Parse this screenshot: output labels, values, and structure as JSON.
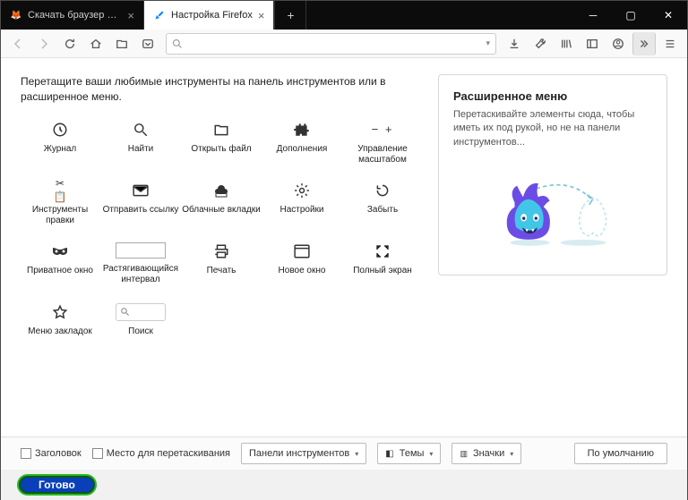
{
  "tabs": [
    {
      "label": "Скачать браузер Firefox для ко",
      "active": false,
      "favicon": "🦊"
    },
    {
      "label": "Настройка Firefox",
      "active": true,
      "favicon": "✎"
    }
  ],
  "instruction": "Перетащите ваши любимые инструменты на панель инструментов или в расширенное меню.",
  "tools": [
    {
      "name": "history",
      "label": "Журнал",
      "icon": "clock"
    },
    {
      "name": "find",
      "label": "Найти",
      "icon": "magnify"
    },
    {
      "name": "open-file",
      "label": "Открыть файл",
      "icon": "folder"
    },
    {
      "name": "addons",
      "label": "Дополнения",
      "icon": "puzzle"
    },
    {
      "name": "zoom",
      "label": "Управление масштабом",
      "icon": "zoom"
    },
    {
      "name": "edit-tools",
      "label": "Инструменты правки",
      "icon": "edit"
    },
    {
      "name": "send-link",
      "label": "Отправить ссылку",
      "icon": "mail"
    },
    {
      "name": "synced-tabs",
      "label": "Облачные вкладки",
      "icon": "cloud"
    },
    {
      "name": "settings",
      "label": "Настройки",
      "icon": "gear"
    },
    {
      "name": "forget",
      "label": "Забыть",
      "icon": "forget"
    },
    {
      "name": "private",
      "label": "Приватное окно",
      "icon": "mask"
    },
    {
      "name": "flex-space",
      "label": "Растягивающийся интервал",
      "icon": "flex"
    },
    {
      "name": "print",
      "label": "Печать",
      "icon": "print"
    },
    {
      "name": "new-window",
      "label": "Новое окно",
      "icon": "window"
    },
    {
      "name": "fullscreen",
      "label": "Полный экран",
      "icon": "fullscreen"
    },
    {
      "name": "bookmarks-menu",
      "label": "Меню закладок",
      "icon": "star"
    },
    {
      "name": "search",
      "label": "Поиск",
      "icon": "searchbox"
    }
  ],
  "overflow": {
    "title": "Расширенное меню",
    "text": "Перетаскивайте элементы сюда, чтобы иметь их под рукой, но не на панели инструментов..."
  },
  "footer": {
    "title_bar": "Заголовок",
    "drag_space": "Место для перетаскивания",
    "toolbars": "Панели инструментов",
    "themes": "Темы",
    "density": "Значки",
    "defaults": "По умолчанию",
    "done": "Готово"
  }
}
